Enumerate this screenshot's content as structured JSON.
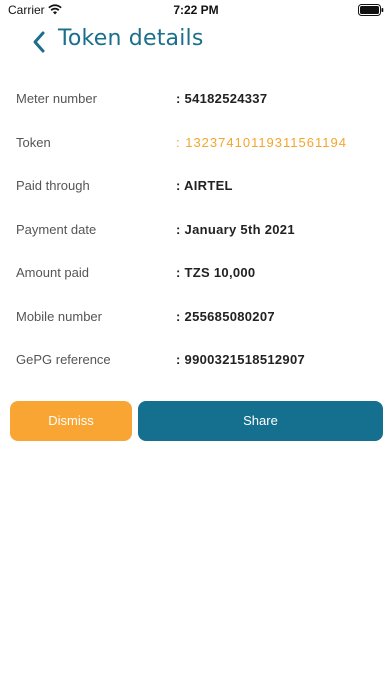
{
  "status_bar": {
    "carrier": "Carrier",
    "time": "7:22 PM"
  },
  "header": {
    "back_icon": "chevron-left-icon",
    "title": "Token details"
  },
  "details": [
    {
      "label": "Meter number",
      "value": ": 54182524337",
      "highlight": false
    },
    {
      "label": "Token",
      "value": ": 13237410119311561194",
      "highlight": true
    },
    {
      "label": "Paid through",
      "value": ": AIRTEL",
      "highlight": false
    },
    {
      "label": "Payment date",
      "value": ": January 5th 2021",
      "highlight": false
    },
    {
      "label": "Amount paid",
      "value": ": TZS 10,000",
      "highlight": false
    },
    {
      "label": "Mobile number",
      "value": ": 255685080207",
      "highlight": false
    },
    {
      "label": "GePG reference",
      "value": ": 9900321518512907",
      "highlight": false
    }
  ],
  "actions": {
    "dismiss_label": "Dismiss",
    "share_label": "Share"
  },
  "colors": {
    "title": "#1b6f8c",
    "accent": "#f5a52c",
    "dismiss": "#f8a534",
    "share": "#14708e"
  }
}
